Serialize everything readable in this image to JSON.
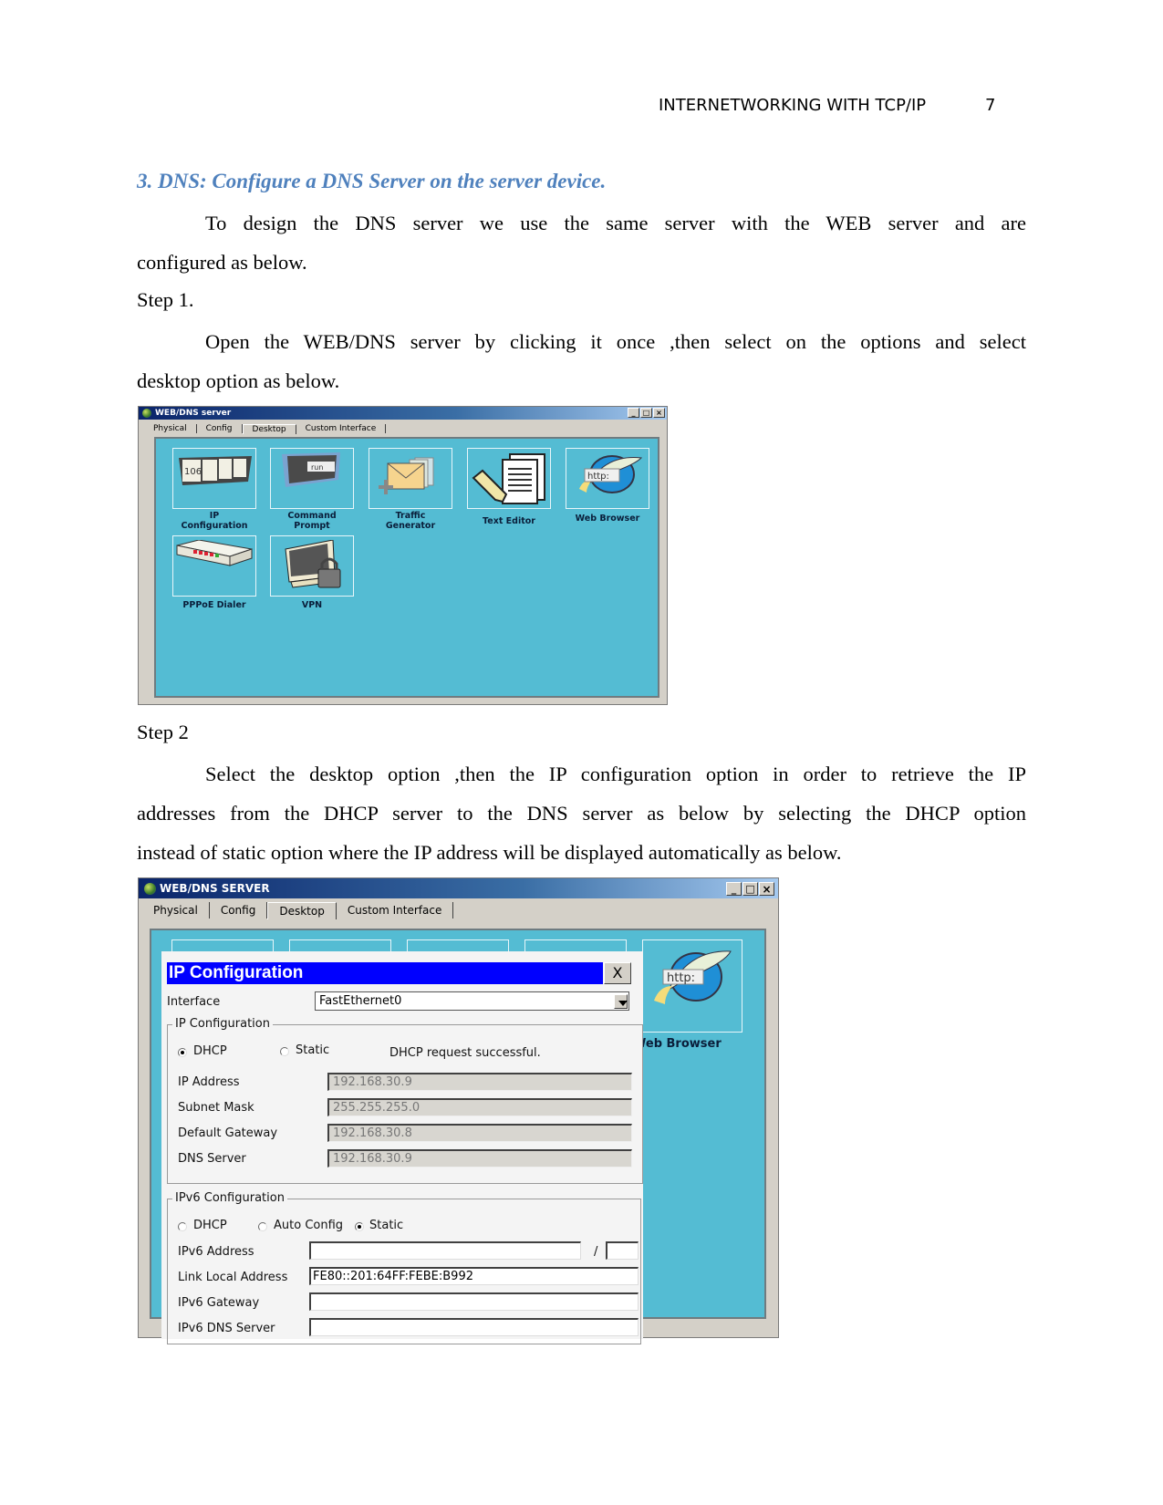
{
  "page_header": {
    "running_title": "INTERNETWORKING WITH TCP/IP",
    "page_number": "7"
  },
  "section": {
    "heading": "3. DNS: Configure a DNS Server on the server device.",
    "intro_lines": [
      "To design the DNS server we use the same server with the WEB server and are",
      "configured as below."
    ],
    "step1_label": "Step 1.",
    "step1_lines": [
      "Open the WEB/DNS server by clicking it once ,then select on the options and select",
      "desktop option as below."
    ],
    "step2_label": "Step 2",
    "step2_lines": [
      "Select the desktop option ,then the IP configuration option in order to retrieve the IP",
      "addresses from the DHCP server to the DNS server as below by selecting the DHCP option",
      "instead of static option where the IP address will be displayed automatically as below."
    ]
  },
  "screenshot1": {
    "window_title": "WEB/DNS server",
    "window_controls": {
      "minimize": "_",
      "maximize": "□",
      "close": "×"
    },
    "tabs": [
      "Physical",
      "Config",
      "Desktop",
      "Custom Interface"
    ],
    "active_tab": "Desktop",
    "apps": [
      {
        "label_line1": "IP",
        "label_line2": "Configuration",
        "icon": "ip-configuration-icon",
        "icon_text": "106"
      },
      {
        "label_line1": "Command",
        "label_line2": "Prompt",
        "icon": "command-prompt-icon",
        "icon_text": "run"
      },
      {
        "label_line1": "Traffic",
        "label_line2": "Generator",
        "icon": "traffic-generator-icon"
      },
      {
        "label_line1": "Text Editor",
        "label_line2": "",
        "icon": "text-editor-icon"
      },
      {
        "label_line1": "Web Browser",
        "label_line2": "",
        "icon": "web-browser-icon",
        "icon_text": "http:"
      },
      {
        "label_line1": "PPPoE Dialer",
        "label_line2": "",
        "icon": "pppoe-dialer-icon"
      },
      {
        "label_line1": "VPN",
        "label_line2": "",
        "icon": "vpn-icon"
      }
    ]
  },
  "screenshot2": {
    "window_title": "WEB/DNS SERVER",
    "window_controls": {
      "minimize": "_",
      "maximize": "□",
      "close": "×"
    },
    "tabs": [
      "Physical",
      "Config",
      "Desktop",
      "Custom Interface"
    ],
    "active_tab": "Desktop",
    "background_app_label": "Web Browser",
    "background_app_icon_text": "http:",
    "dialog": {
      "title": "IP Configuration",
      "close_label": "X",
      "interface_label": "Interface",
      "interface_value": "FastEthernet0",
      "ipv4_group_label": "IP Configuration",
      "ipv4_mode_options": [
        "DHCP",
        "Static"
      ],
      "ipv4_mode_selected": "DHCP",
      "status_message": "DHCP request successful.",
      "ipv4_fields": [
        {
          "label": "IP Address",
          "value": "192.168.30.9"
        },
        {
          "label": "Subnet Mask",
          "value": "255.255.255.0"
        },
        {
          "label": "Default Gateway",
          "value": "192.168.30.8"
        },
        {
          "label": "DNS Server",
          "value": "192.168.30.9"
        }
      ],
      "ipv6_group_label": "IPv6 Configuration",
      "ipv6_mode_options": [
        "DHCP",
        "Auto Config",
        "Static"
      ],
      "ipv6_mode_selected": "Static",
      "ipv6_prefix_separator": "/",
      "ipv6_fields": [
        {
          "label": "IPv6 Address",
          "value": "",
          "prefix": ""
        },
        {
          "label": "Link Local Address",
          "value": "FE80::201:64FF:FEBE:B992"
        },
        {
          "label": "IPv6 Gateway",
          "value": ""
        },
        {
          "label": "IPv6 DNS Server",
          "value": ""
        }
      ]
    }
  }
}
